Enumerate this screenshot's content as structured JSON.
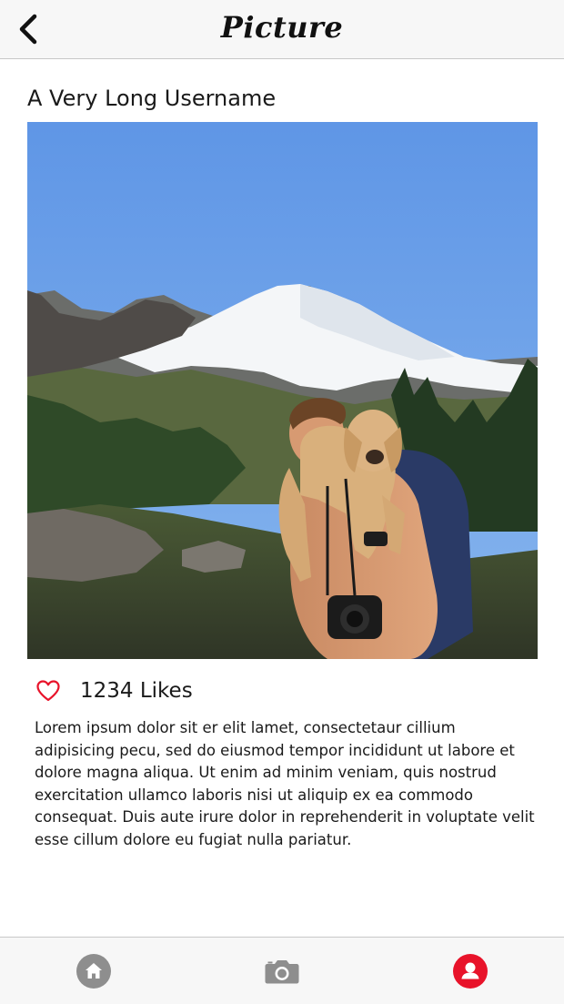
{
  "navbar": {
    "title": "Picture",
    "back_icon": "chevron-left-icon"
  },
  "post": {
    "username": "A Very Long Username",
    "photo": {
      "subject": "hiker-holding-puppy-mountain-scene"
    },
    "likes": {
      "icon": "heart-outline-icon",
      "label": "1234 Likes"
    },
    "caption": "Lorem ipsum dolor sit er elit lamet, consectetaur cillium adipisicing pecu, sed do eiusmod tempor incididunt ut labore et dolore magna aliqua. Ut enim ad minim veniam, quis nostrud exercitation ullamco laboris nisi ut aliquip ex ea commodo consequat. Duis aute irure dolor in reprehenderit in voluptate velit esse cillum dolore eu fugiat nulla pariatur."
  },
  "tabbar": {
    "tabs": [
      {
        "name": "home",
        "icon": "home-icon",
        "active": false
      },
      {
        "name": "camera",
        "icon": "camera-icon",
        "active": false
      },
      {
        "name": "profile",
        "icon": "profile-icon",
        "active": true
      }
    ]
  },
  "colors": {
    "accent": "#e8132a",
    "inactive_icon": "#8e8e8e",
    "bar_background": "#f7f7f7",
    "text": "#1a1a1a"
  }
}
